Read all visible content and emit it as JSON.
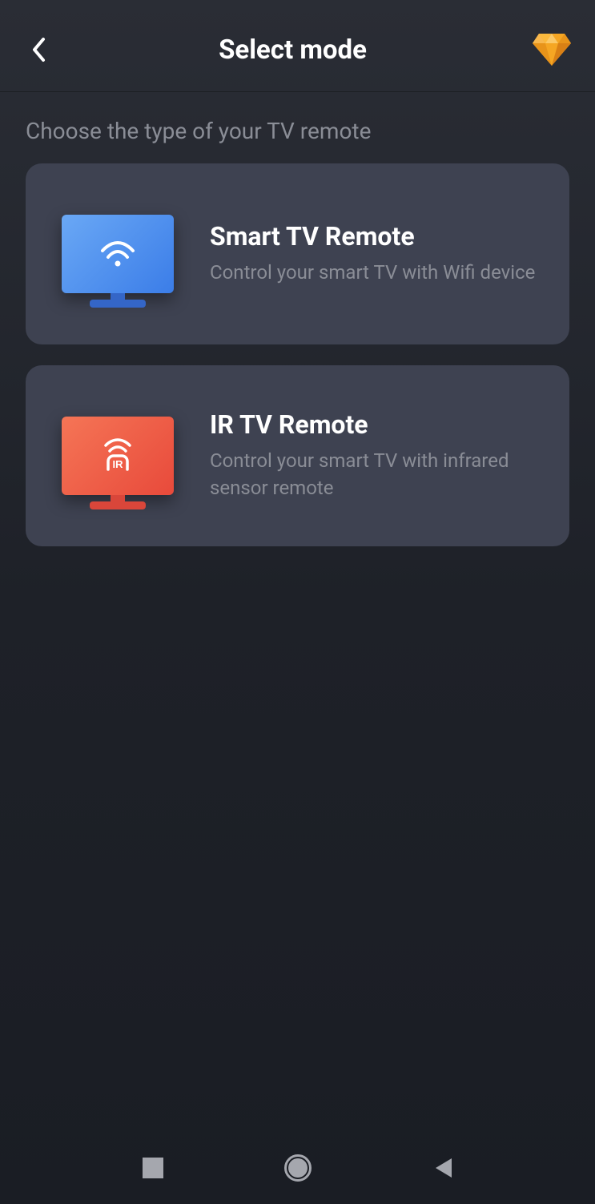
{
  "header": {
    "title": "Select mode"
  },
  "subtitle": "Choose the type of your TV remote",
  "cards": [
    {
      "title": "Smart TV Remote",
      "description": "Control your smart TV with Wifi device"
    },
    {
      "title": "IR TV Remote",
      "description": "Control your smart TV with infrared sensor remote"
    }
  ]
}
